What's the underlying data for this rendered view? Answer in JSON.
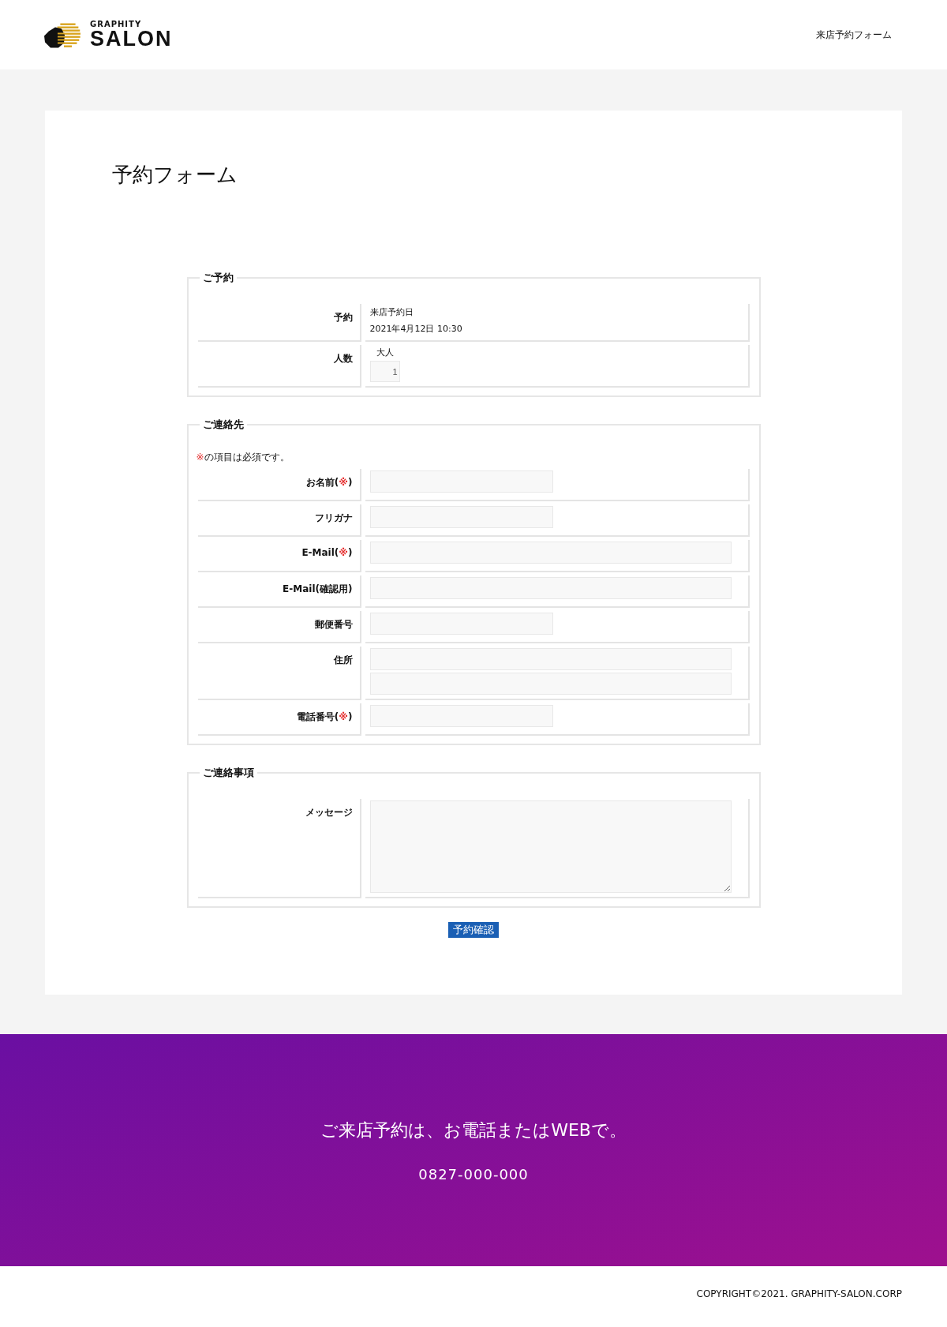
{
  "header": {
    "logo_small": "GRAPHITY",
    "logo_large": "SALON",
    "nav_link": "来店予約フォーム"
  },
  "page_title": "予約フォーム",
  "sections": [
    {
      "legend": "ご予約",
      "rows": [
        {
          "kind": "text",
          "label": "予約",
          "lines": [
            "来店予約日",
            "2021年4月12日 10:30"
          ]
        },
        {
          "kind": "count",
          "label": "人数",
          "caption": "大人",
          "value": "1"
        }
      ]
    },
    {
      "legend": "ご連絡先",
      "note_mark": "※",
      "note": "の項目は必須です。",
      "rows": [
        {
          "kind": "short",
          "label": "お名前(",
          "required_mark": "※",
          "label_end": ")"
        },
        {
          "kind": "short",
          "label": "フリガナ"
        },
        {
          "kind": "long",
          "label": "E-Mail(",
          "required_mark": "※",
          "label_end": ")"
        },
        {
          "kind": "long",
          "label": "E-Mail(確認用)"
        },
        {
          "kind": "short",
          "label": "郵便番号"
        },
        {
          "kind": "double",
          "label": "住所"
        },
        {
          "kind": "short",
          "label": "電話番号(",
          "required_mark": "※",
          "label_end": ")"
        }
      ]
    },
    {
      "legend": "ご連絡事項",
      "rows": [
        {
          "kind": "textarea",
          "label": "メッセージ"
        }
      ]
    }
  ],
  "submit": "予約確認",
  "footer": {
    "headline": "ご来店予約は、お電話またはWEBで。",
    "phone": "0827-000-000"
  },
  "copyright": "COPYRIGHT©2021. GRAPHITY-SALON.CORP"
}
